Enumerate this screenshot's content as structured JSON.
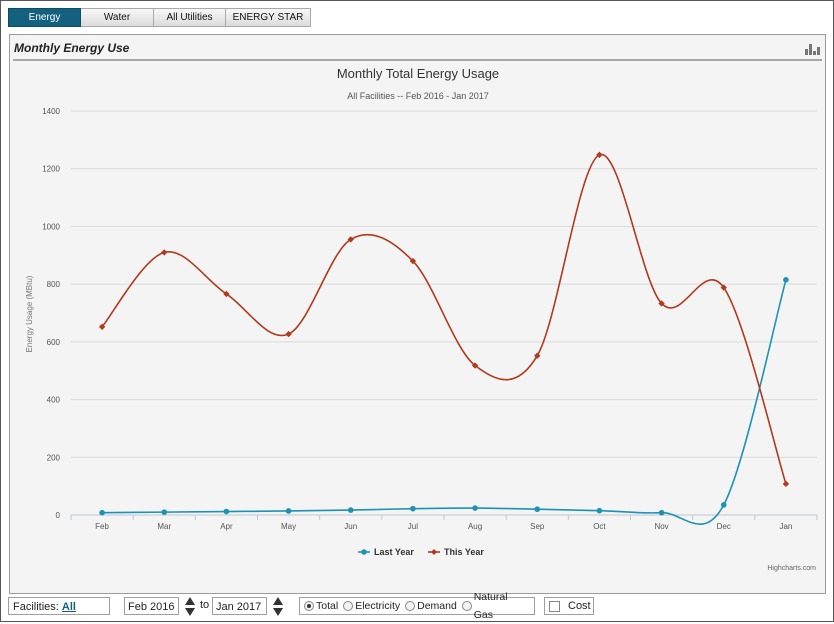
{
  "tabs": [
    {
      "label": "Energy",
      "active": true
    },
    {
      "label": "Water",
      "active": false
    },
    {
      "label": "All Utilities",
      "active": false
    },
    {
      "label": "ENERGY STAR",
      "active": false
    }
  ],
  "panel": {
    "title": "Monthly Energy Use",
    "icon": "bar-chart-icon"
  },
  "chart_data": {
    "type": "line",
    "title": "Monthly Total Energy Usage",
    "subtitle": "All Facilities -- Feb 2016 - Jan 2017",
    "ylabel": "Energy Usage (MBtu)",
    "xlabel": "",
    "categories": [
      "Feb",
      "Mar",
      "Apr",
      "May",
      "Jun",
      "Jul",
      "Aug",
      "Sep",
      "Oct",
      "Nov",
      "Dec",
      "Jan"
    ],
    "ylim": [
      0,
      1400
    ],
    "yticks": [
      0,
      200,
      400,
      600,
      800,
      1000,
      1200,
      1400
    ],
    "grid": true,
    "legend_position": "bottom-center",
    "series": [
      {
        "name": "Last Year",
        "color": "#1d93b3",
        "marker": "circle",
        "values": [
          8,
          10,
          12,
          14,
          17,
          22,
          24,
          20,
          15,
          8,
          35,
          815
        ]
      },
      {
        "name": "This Year",
        "color": "#b13a1e",
        "marker": "diamond",
        "values": [
          652,
          910,
          766,
          627,
          955,
          880,
          518,
          552,
          1248,
          733,
          788,
          108
        ]
      }
    ],
    "credit": "Highcharts.com"
  },
  "footer": {
    "facilities_label": "Facilities:",
    "facilities_value": "All",
    "from_date": "Feb 2016",
    "to_label": "to",
    "to_date": "Jan 2017",
    "radio_options": [
      {
        "label": "Total",
        "selected": true
      },
      {
        "label": "Electricity",
        "selected": false
      },
      {
        "label": "Demand",
        "selected": false
      },
      {
        "label": "Natural Gas",
        "selected": false
      }
    ],
    "cost_label": "Cost"
  }
}
